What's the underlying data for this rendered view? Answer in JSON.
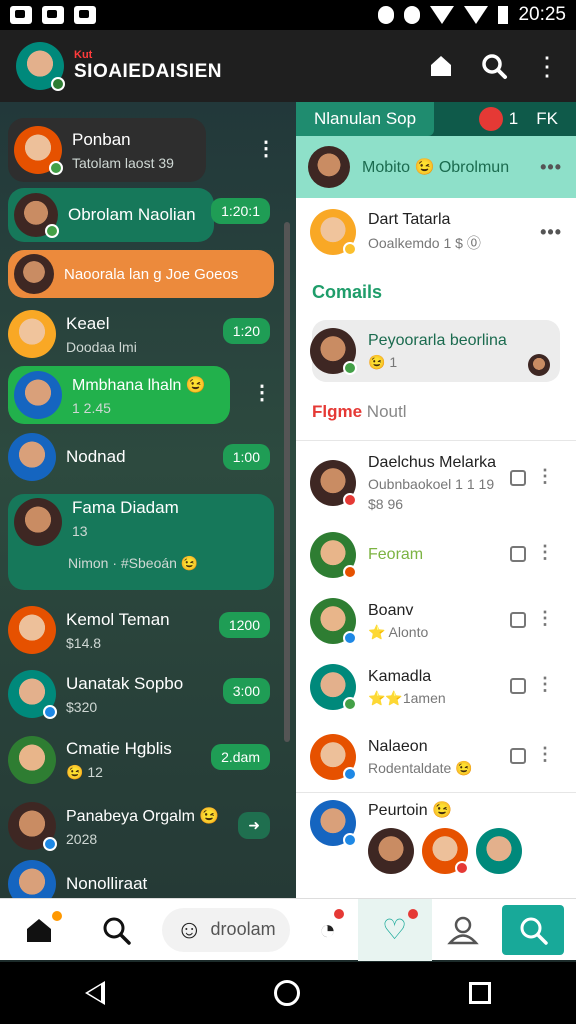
{
  "status_bar": {
    "time": "20:25"
  },
  "app_bar": {
    "brand_small": "Kut",
    "title": "SIOAIEDAISIEN"
  },
  "left_chats": [
    {
      "name": "Ponban",
      "sub": "Tatolam laost 39"
    },
    {
      "name": "Obrolam Naolian",
      "badge": "1:20:1"
    },
    {
      "name": "Naoorala lan g  Joe Goeos"
    },
    {
      "name": "Keael",
      "sub": "Doodaa lmi",
      "badge": "1:20"
    },
    {
      "name": "Mmbhana lhaln 😉",
      "sub": "1 2.45"
    },
    {
      "name": "Nodnad",
      "badge": "1:00"
    },
    {
      "name": "Fama Diadam",
      "sub": "13",
      "extra": "Nimon · #Sbeoán 😉"
    },
    {
      "name": "Kemol Teman",
      "sub": "$14.8",
      "badge": "1200"
    },
    {
      "name": "Uanatak Sopbo",
      "sub": "$320",
      "badge": "3:00"
    },
    {
      "name": "Cmatie Hgblis",
      "sub": "😉 12",
      "badge": "2.dam"
    },
    {
      "name": "Panabeya Orgalm 😉",
      "sub": "2028"
    },
    {
      "name": "Nonolliraat"
    }
  ],
  "right_panel": {
    "tab_active": "Nlanulan Sop",
    "tab_count": "1",
    "tab_label": "FK",
    "header_name": "Mobito 😉 Obrolmun",
    "pinned": {
      "name": "Dart Tatarla",
      "sub": "Ooalkemdo 1 $ ⓪"
    },
    "section_comments": "Comails",
    "bubble": {
      "text": "Peyoorarla beorlina",
      "count": "😉 1"
    },
    "section_new": "Flgme",
    "section_new_suffix": "Noutl",
    "contacts": [
      {
        "name": "Daelchus Melarka",
        "sub": "Oubnbaokoel 1 1 19",
        "sub2": "$8 96"
      },
      {
        "name": "Feoram"
      },
      {
        "name": "Boanv",
        "sub": "⭐ Alonto"
      },
      {
        "name": "Kamadla",
        "sub": "⭐⭐1amen"
      },
      {
        "name": "Nalaeon",
        "sub": "Rodentaldate 😉"
      },
      {
        "name": "Peurtoin 😉"
      }
    ]
  },
  "bottom_nav": {
    "compose_label": "droolam"
  },
  "colors": {
    "accent": "#18a999",
    "green": "#1f9d55",
    "orange": "#ec8a3c",
    "teal_header": "#8ee0c9"
  }
}
